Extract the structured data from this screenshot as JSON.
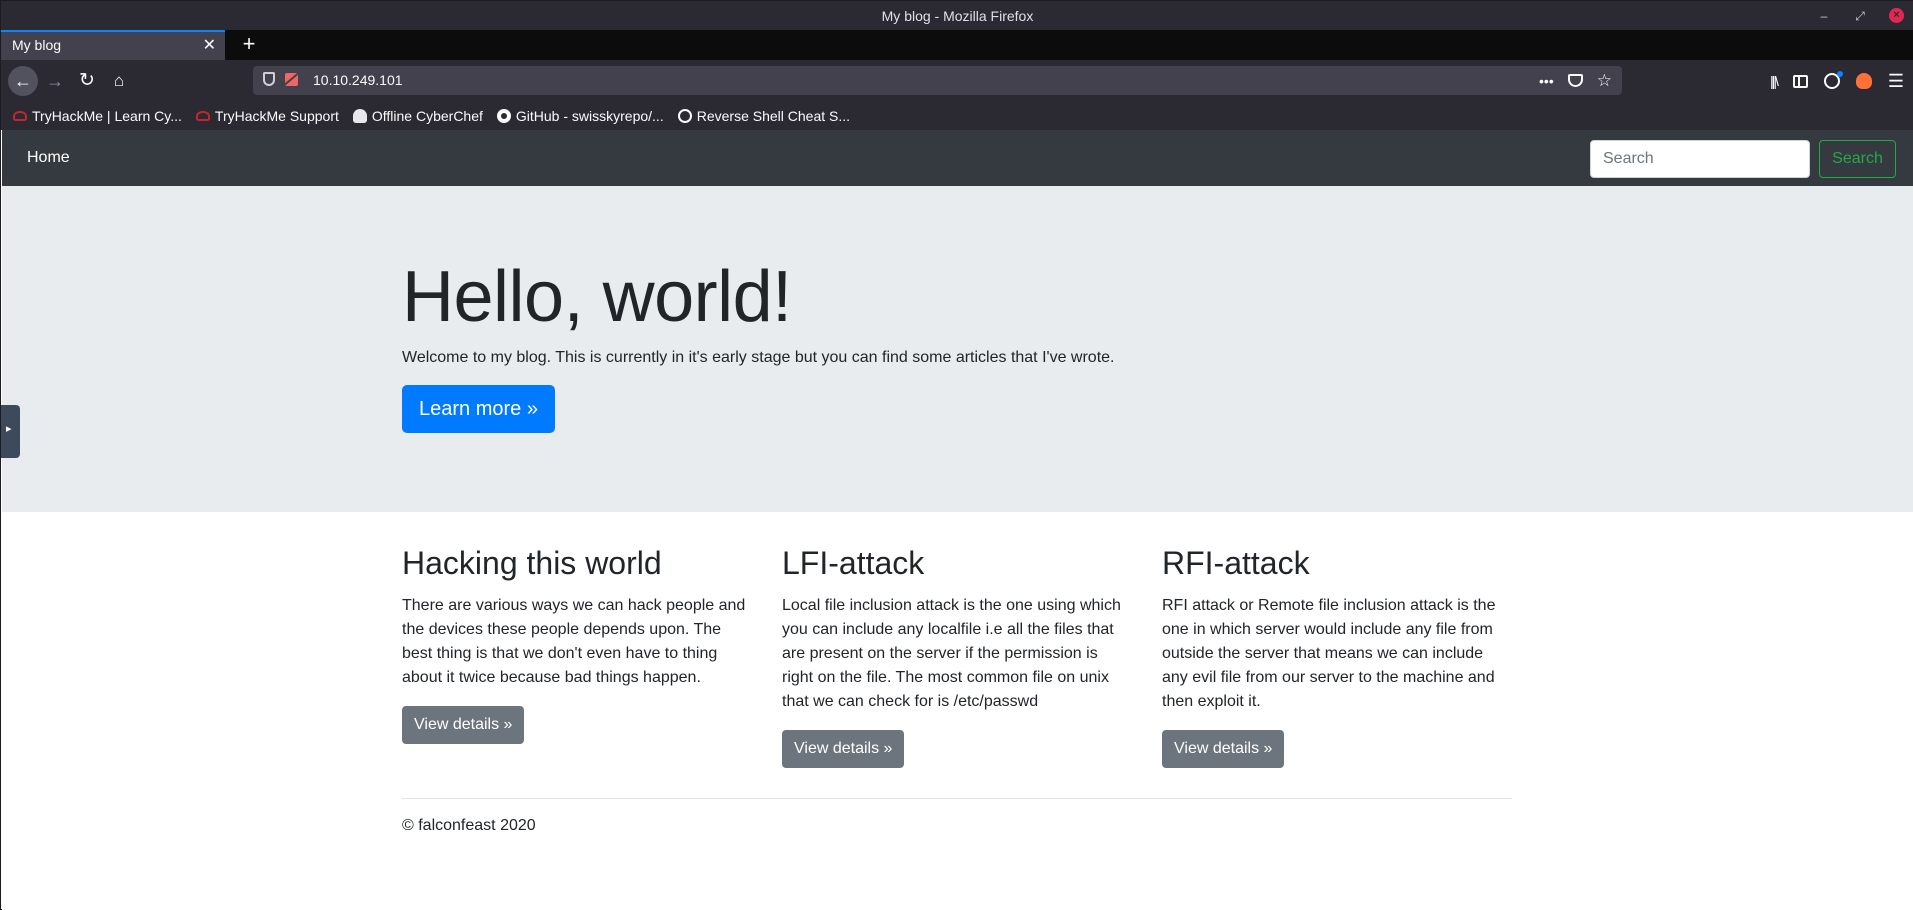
{
  "window": {
    "title": "My blog - Mozilla Firefox"
  },
  "tab": {
    "label": "My blog",
    "close": "✕",
    "new_tab": "+"
  },
  "urlbar": {
    "url": "10.10.249.101",
    "more": "•••",
    "star": "☆"
  },
  "toolbar": {
    "menu": "☰",
    "library": "|||\\"
  },
  "bookmarks": [
    {
      "label": "TryHackMe | Learn Cy...",
      "icon": "tryhackme-icon"
    },
    {
      "label": "TryHackMe Support",
      "icon": "tryhackme-icon"
    },
    {
      "label": "Offline CyberChef",
      "icon": "cyberchef-icon"
    },
    {
      "label": "GitHub - swisskyrepo/...",
      "icon": "github-icon"
    },
    {
      "label": "Reverse Shell Cheat S...",
      "icon": "globe-icon"
    }
  ],
  "site_nav": {
    "home": "Home",
    "search_placeholder": "Search",
    "search_button": "Search"
  },
  "hero": {
    "title": "Hello, world!",
    "lead": "Welcome to my blog. This is currently in it's early stage but you can find some articles that I've wrote.",
    "button": "Learn more »"
  },
  "articles": [
    {
      "title": "Hacking this world",
      "body": "There are various ways we can hack people and the devices these people depends upon. The best thing is that we don't even have to thing about it twice because bad things happen.",
      "button": "View details »"
    },
    {
      "title": "LFI-attack",
      "body": "Local file inclusion attack is the one using which you can include any localfile i.e all the files that are present on the server if the permission is right on the file. The most common file on unix that we can check for is /etc/passwd",
      "button": "View details »"
    },
    {
      "title": "RFI-attack",
      "body": "RFI attack or Remote file inclusion attack is the one in which server would include any file from outside the server that means we can include any evil file from our server to the machine and then exploit it.",
      "button": "View details »"
    }
  ],
  "footer": {
    "text": "© falconfeast 2020"
  },
  "colors": {
    "navbar": "#343a40",
    "jumbotron": "#e9ecef",
    "primary": "#007bff",
    "secondary": "#6c757d",
    "success": "#28a745"
  }
}
